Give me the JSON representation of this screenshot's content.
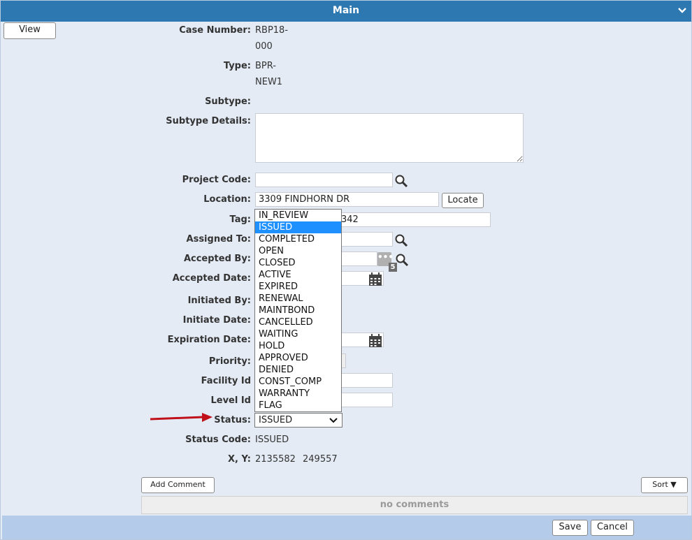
{
  "window": {
    "title": "Main"
  },
  "toolbar": {
    "view_label": "View"
  },
  "fields": {
    "case_number": {
      "label": "Case Number:",
      "value_line1": "RBP18-",
      "value_line2": "000"
    },
    "type": {
      "label": "Type:",
      "value_line1": "BPR-",
      "value_line2": "NEW1"
    },
    "subtype": {
      "label": "Subtype:"
    },
    "subtype_details": {
      "label": "Subtype Details:",
      "value": ""
    },
    "project_code": {
      "label": "Project Code:",
      "value": ""
    },
    "location": {
      "label": "Location:",
      "value": "3309 FINDHORN DR",
      "locate_label": "Locate"
    },
    "tag": {
      "label": "Tag:",
      "value_visible": "342"
    },
    "assigned_to": {
      "label": "Assigned To:"
    },
    "accepted_by": {
      "label": "Accepted By:",
      "badge": "5"
    },
    "accepted_date": {
      "label": "Accepted Date:"
    },
    "initiated_by": {
      "label": "Initiated By:"
    },
    "initiate_date": {
      "label": "Initiate Date:"
    },
    "expiration_date": {
      "label": "Expiration Date:"
    },
    "priority": {
      "label": "Priority:"
    },
    "facility_id": {
      "label": "Facility Id"
    },
    "level_id": {
      "label": "Level Id"
    },
    "status": {
      "label": "Status:",
      "selected": "ISSUED"
    },
    "status_code": {
      "label": "Status Code:",
      "value": "ISSUED"
    },
    "xy": {
      "label": "X, Y:",
      "x": "2135582",
      "y": "249557"
    }
  },
  "status_options": [
    "IN_REVIEW",
    "ISSUED",
    "COMPLETED",
    "OPEN",
    "CLOSED",
    "ACTIVE",
    "EXPIRED",
    "RENEWAL",
    "MAINTBOND",
    "CANCELLED",
    "WAITING",
    "HOLD",
    "APPROVED",
    "DENIED",
    "CONST_COMP",
    "WARRANTY",
    "FLAG"
  ],
  "status_selected_index": 1,
  "comments": {
    "add_label": "Add Comment",
    "sort_label": "Sort ▼",
    "empty_text": "no comments"
  },
  "footer": {
    "save_label": "Save",
    "cancel_label": "Cancel"
  },
  "colors": {
    "title_bar": "#2e78b1",
    "panel": "#e4ebf5",
    "footer": "#b4ccea",
    "selected_option": "#1e90ff",
    "arrow": "#c0101a"
  }
}
